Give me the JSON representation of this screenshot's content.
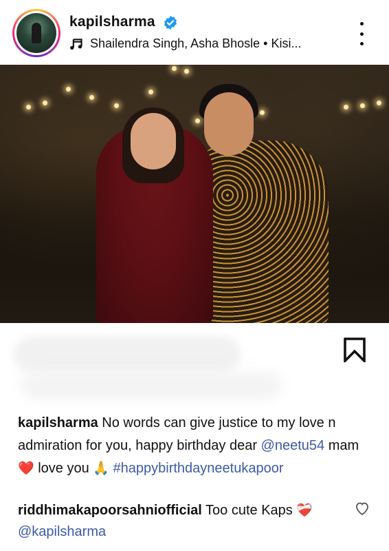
{
  "post": {
    "username": "kapilsharma",
    "song": "Shailendra Singh,  Asha Bhosle • Kisi...",
    "caption": {
      "username": "kapilsharma",
      "text_1": "No words can give justice to my love n admiration for you, happy birthday dear",
      "mention": "@neetu54",
      "text_2": "mam",
      "heart_emoji": "❤️",
      "text_3": "love you",
      "pray_emoji": "🙏",
      "hashtag": "#happybirthdayneetukapoor"
    }
  },
  "comment": {
    "username": "riddhimakapoorsahniofficial",
    "text": "Too cute Kaps",
    "emoji": "❤️‍🩹",
    "mention": "@kapilsharma"
  },
  "colors": {
    "link": "#3b5aa8",
    "verified_badge": "#1d9bf0"
  },
  "icons": [
    "verified-badge-icon",
    "music-note-icon",
    "more-options-icon",
    "bookmark-icon",
    "heart-outline-icon"
  ]
}
